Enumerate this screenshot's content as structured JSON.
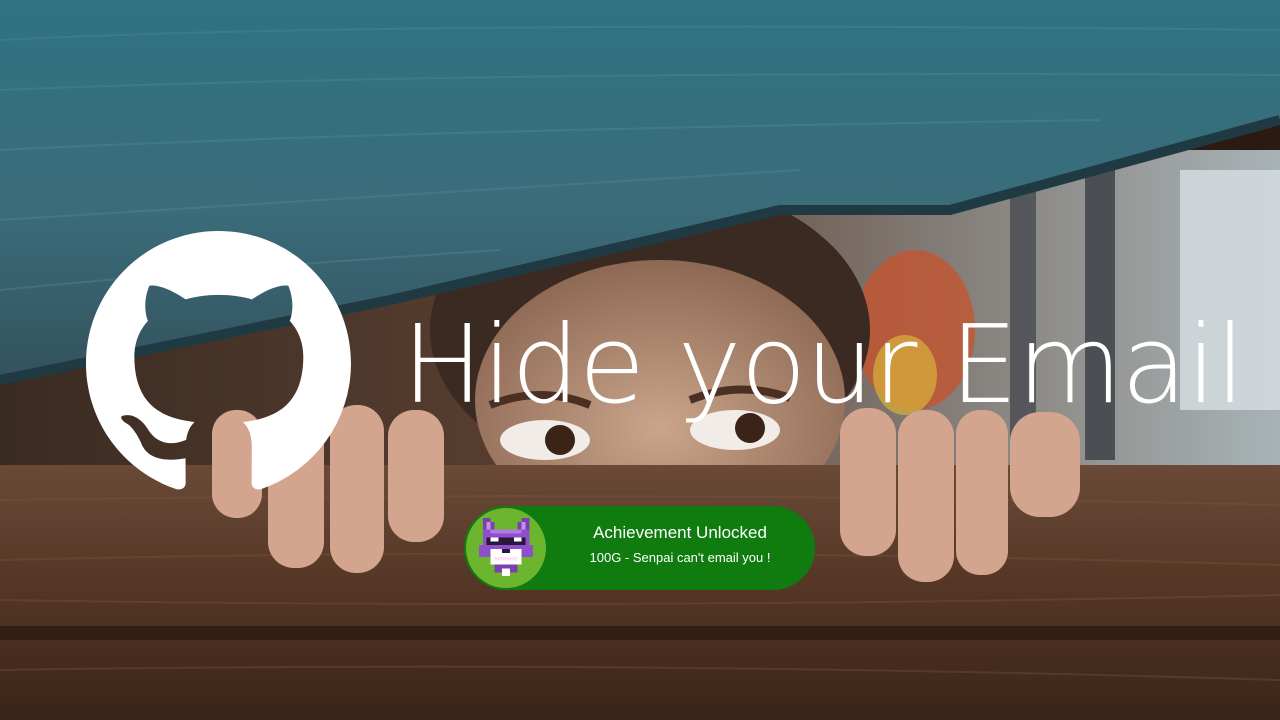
{
  "banner": {
    "title": "Hide your Email",
    "logo_icon": "github-octocat-icon"
  },
  "achievement": {
    "title": "Achievement Unlocked",
    "subtitle": "100G - Senpai can't email you !",
    "avatar_icon": "pixel-fox-icon",
    "badge_color": "#107c10",
    "avatar_bg_color": "#6cb52f"
  }
}
